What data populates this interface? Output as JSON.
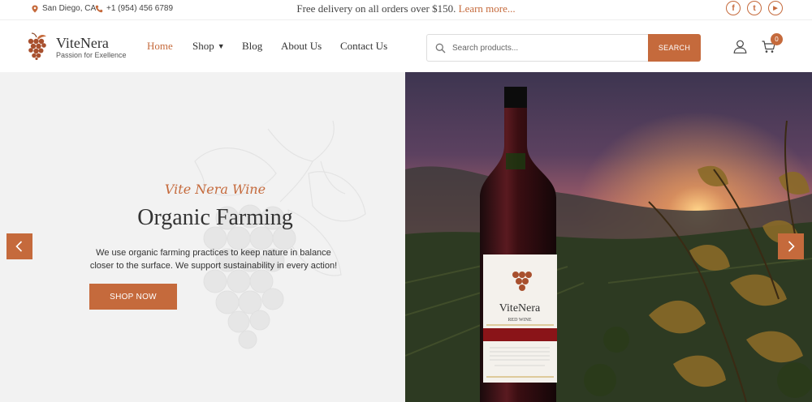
{
  "topbar": {
    "location": "San Diego, CA",
    "phone": "+1 (954) 456 6789",
    "promo_text": "Free delivery on all orders over $150.",
    "promo_link": "Learn more..."
  },
  "social": {
    "facebook": "f",
    "twitter": "t",
    "youtube": "▶"
  },
  "brand": {
    "name": "ViteNera",
    "tagline": "Passion for Exellence",
    "accent": "#c56a3c"
  },
  "nav": {
    "home": "Home",
    "shop": "Shop",
    "blog": "Blog",
    "about": "About Us",
    "contact": "Contact Us"
  },
  "search": {
    "placeholder": "Search products...",
    "button": "SEARCH"
  },
  "cart": {
    "count": "0"
  },
  "hero": {
    "subtitle": "Vite Nera Wine",
    "title": "Organic Farming",
    "description": "We use organic farming practices to keep nature in balance closer to the surface. We support sustainability in every action!",
    "button": "SHOP NOW",
    "bottle_brand": "ViteNera",
    "bottle_type": "RED WINE"
  },
  "icons": {
    "location": "map-pin-icon",
    "phone": "phone-icon",
    "search": "search-icon",
    "user": "user-icon",
    "cart": "cart-icon",
    "prev": "chevron-left-icon",
    "next": "chevron-right-icon"
  }
}
